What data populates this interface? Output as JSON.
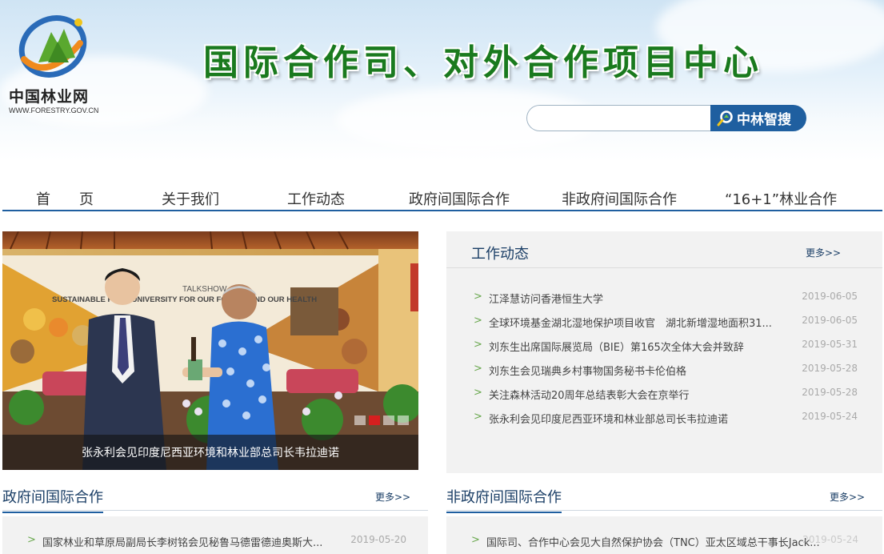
{
  "header": {
    "logo_cn": "中国林业网",
    "logo_en": "WWW.FORESTRY.GOV.CN",
    "title": "国际合作司、对外合作项目中心",
    "search_placeholder": "",
    "search_button": "中林智搜"
  },
  "nav": {
    "items": [
      "首　　页",
      "关于我们",
      "工作动态",
      "政府间国际合作",
      "非政府间国际合作",
      "“16+1”林业合作"
    ]
  },
  "slider": {
    "caption": "张永利会见印度尼西亚环境和林业部总司长韦拉迪诺",
    "backdrop_line1": "TALKSHOW",
    "backdrop_line2": "SUSTAINABLE FOOD UNIVERSITY FOR OUR FOREST AND OUR HEALTH",
    "dot_count": 4,
    "active_dot": 2
  },
  "work": {
    "title": "工作动态",
    "more": "更多>>",
    "items": [
      {
        "text": "江泽慧访问香港恒生大学",
        "date": "2019-06-05"
      },
      {
        "text": "全球环境基金湖北湿地保护项目收官　湖北新增湿地面积31...",
        "date": "2019-06-05"
      },
      {
        "text": "刘东生出席国际展览局（BIE）第165次全体大会并致辞",
        "date": "2019-05-31"
      },
      {
        "text": "刘东生会见瑞典乡村事物国务秘书卡伦伯格",
        "date": "2019-05-28"
      },
      {
        "text": "关注森林活动20周年总结表彰大会在京举行",
        "date": "2019-05-28"
      },
      {
        "text": "张永利会见印度尼西亚环境和林业部总司长韦拉迪诺",
        "date": "2019-05-24"
      }
    ]
  },
  "gov": {
    "title": "政府间国际合作",
    "more": "更多>>",
    "items": [
      {
        "text": "国家林业和草原局副局长李树铭会见秘鲁马德雷德迪奥斯大...",
        "date": "2019-05-20"
      }
    ]
  },
  "ngo": {
    "title": "非政府间国际合作",
    "more": "更多>>",
    "items": [
      {
        "text": "国际司、合作中心会见大自然保护协会（TNC）亚太区域总干事长Jack...",
        "date": "2019-05-24"
      }
    ]
  },
  "colors": {
    "brand_blue": "#1f5fa0",
    "title_green": "#1a7a1e",
    "bullet_green": "#6aa84f",
    "active_dot": "#d61f1f"
  }
}
